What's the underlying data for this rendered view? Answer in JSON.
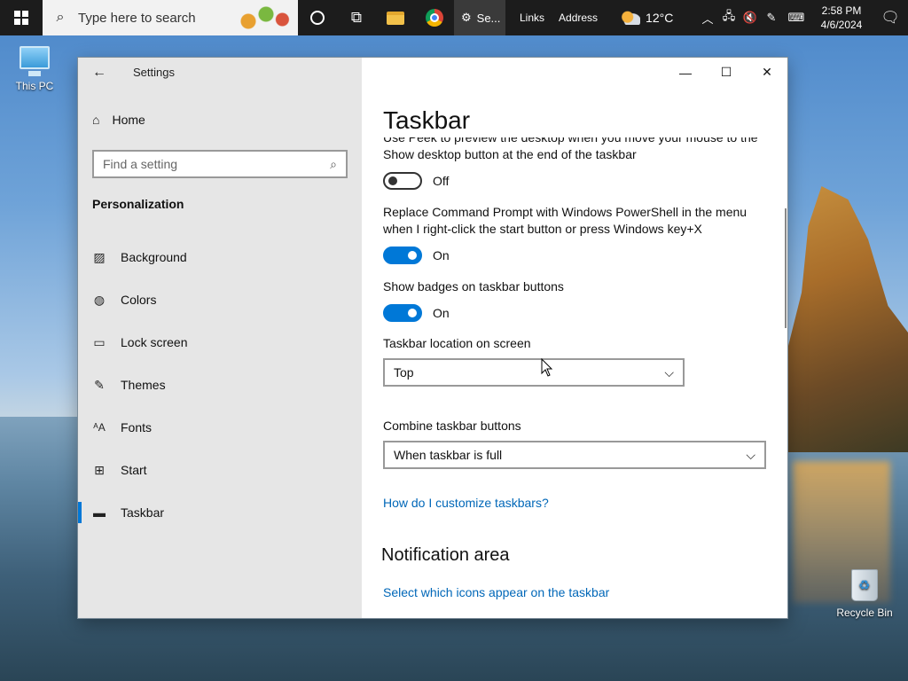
{
  "taskbar": {
    "search_placeholder": "Type here to search",
    "active_app_label": "Se...",
    "links_label": "Links",
    "address_label": "Address",
    "weather_temp": "12°C",
    "time": "2:58 PM",
    "date": "4/6/2024"
  },
  "desktop": {
    "this_pc": "This PC",
    "recycle_bin": "Recycle Bin"
  },
  "window": {
    "app_title": "Settings",
    "home_label": "Home",
    "search_placeholder": "Find a setting",
    "section_label": "Personalization",
    "nav_items": [
      {
        "label": "Background"
      },
      {
        "label": "Colors"
      },
      {
        "label": "Lock screen"
      },
      {
        "label": "Themes"
      },
      {
        "label": "Fonts"
      },
      {
        "label": "Start"
      },
      {
        "label": "Taskbar"
      }
    ],
    "page_title": "Taskbar"
  },
  "settings": {
    "peek": {
      "desc": "Use Peek to preview the desktop when you move your mouse to the Show desktop button at the end of the taskbar",
      "state": "Off"
    },
    "powershell": {
      "desc": "Replace Command Prompt with Windows PowerShell in the menu when I right-click the start button or press Windows key+X",
      "state": "On"
    },
    "badges": {
      "desc": "Show badges on taskbar buttons",
      "state": "On"
    },
    "location": {
      "label": "Taskbar location on screen",
      "value": "Top"
    },
    "combine": {
      "label": "Combine taskbar buttons",
      "value": "When taskbar is full"
    },
    "help_link": "How do I customize taskbars?",
    "notification_heading": "Notification area",
    "icons_link": "Select which icons appear on the taskbar"
  }
}
